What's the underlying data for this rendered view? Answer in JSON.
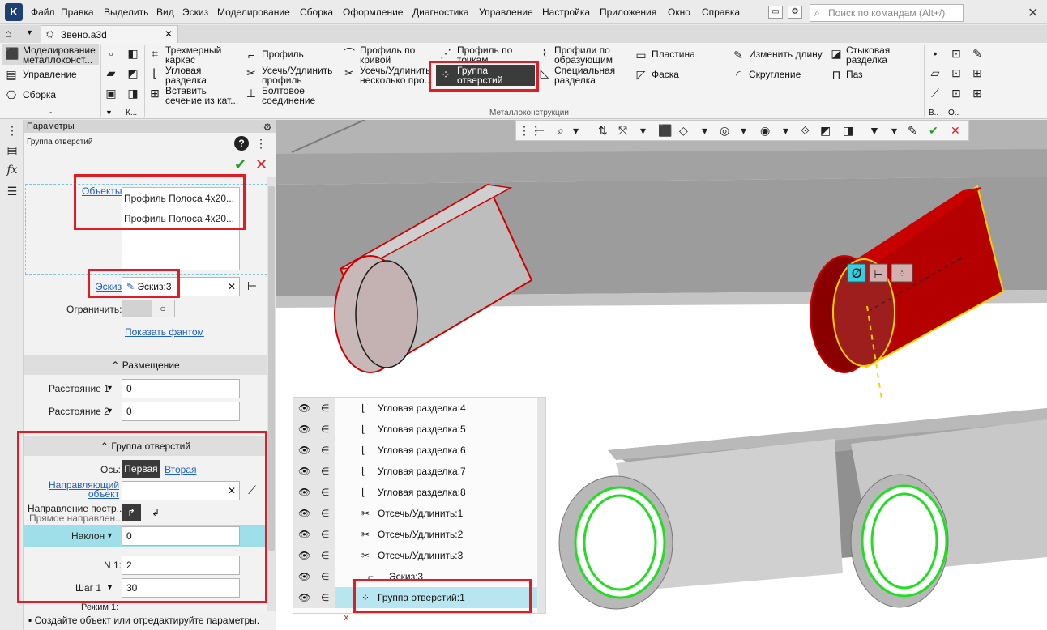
{
  "menu": {
    "items": [
      "Файл",
      "Правка",
      "Выделить",
      "Вид",
      "Эскиз",
      "Моделирование",
      "Сборка",
      "Оформление",
      "Диагностика",
      "Управление",
      "Настройка",
      "Приложения",
      "Окно",
      "Справка"
    ],
    "search_placeholder": "Поиск по командам (Alt+/)"
  },
  "tab": {
    "title": "Звено.a3d"
  },
  "ribbon": {
    "modes": [
      "Моделирование\nметаллоконст...",
      "Управление",
      "Сборка"
    ],
    "sketch_btn": "К...",
    "col1": [
      "Трехмерный\nкаркас",
      "Угловая\nразделка",
      "Вставить\nсечение из кат..."
    ],
    "col2": [
      "Профиль",
      "Усечь/Удлинить\nпрофиль",
      "Болтовое\nсоединение"
    ],
    "col3": [
      "Профиль по\nкривой",
      "Усечь/Удлинить\nнесколько про..."
    ],
    "col4": [
      "Профиль по\nточкам",
      "Группа\nотверстий"
    ],
    "col5": [
      "Профили по\nобразующим",
      "Специальная\nразделка"
    ],
    "col6": [
      "Пластина",
      "Фаска"
    ],
    "col7": [
      "Изменить длину",
      "Скругление"
    ],
    "col8": [
      "Стыковая\nразделка",
      "Паз"
    ],
    "group_label": "Металлоконструкции",
    "small_labels": [
      "В..",
      "О.."
    ]
  },
  "panel": {
    "header": "Параметры",
    "title": "Группа отверстий",
    "objects_label": "Объекты",
    "objects": [
      "Профиль Полоса 4х20...",
      "Профиль Полоса 4х20..."
    ],
    "sketch_label": "Эскиз",
    "sketch_value": "Эскиз:3",
    "limit_label": "Ограничить:",
    "show_phantom": "Показать фантом",
    "placement_section": "Размещение",
    "dist1_label": "Расстояние 1",
    "dist1_value": "0",
    "dist2_label": "Расстояние 2",
    "dist2_value": "0",
    "group_section": "Группа отверстий",
    "axis_label": "Ось:",
    "axis_first": "Первая",
    "axis_second": "Вторая",
    "dir_obj_label": "Направляющий\nобъект",
    "build_dir_label": "Направление постр...",
    "build_dir_value": "Прямое направлен...",
    "tilt_label": "Наклон",
    "tilt_value": "0",
    "n1_label": "N 1:",
    "n1_value": "2",
    "step1_label": "Шаг 1",
    "step1_value": "30",
    "mode_label": "Режим 1:"
  },
  "status": {
    "text": "Создайте объект или отредактируйте параметры."
  },
  "tree": {
    "items": [
      "Угловая разделка:4",
      "Угловая разделка:5",
      "Угловая разделка:6",
      "Угловая разделка:7",
      "Угловая разделка:8",
      "Отсечь/Удлинить:1",
      "Отсечь/Удлинить:2",
      "Отсечь/Удлинить:3",
      "Эскиз:3",
      "Группа отверстий:1"
    ]
  },
  "colors": {
    "highlight": "#e01d26",
    "selected_row": "#b7e6f0",
    "body_red": "#b40000",
    "ring_green": "#22dd22"
  }
}
